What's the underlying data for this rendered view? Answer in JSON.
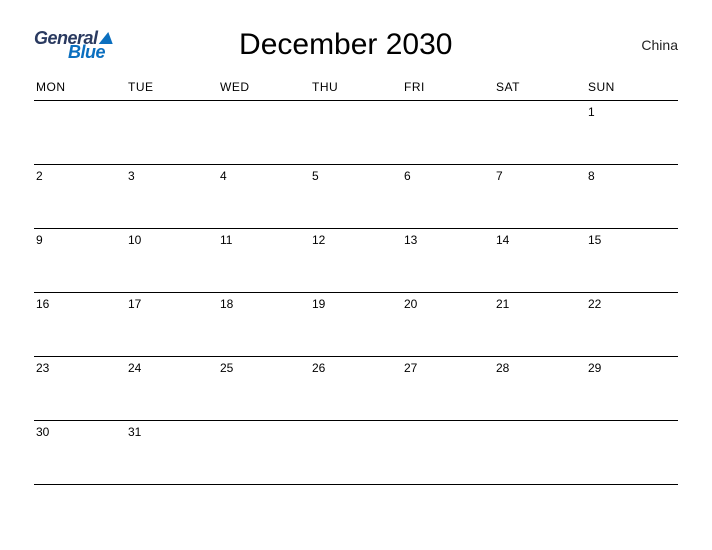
{
  "logo": {
    "word1": "General",
    "word2": "Blue"
  },
  "title": "December 2030",
  "region": "China",
  "dows": [
    "MON",
    "TUE",
    "WED",
    "THU",
    "FRI",
    "SAT",
    "SUN"
  ],
  "weeks": [
    [
      "",
      "",
      "",
      "",
      "",
      "",
      "1"
    ],
    [
      "2",
      "3",
      "4",
      "5",
      "6",
      "7",
      "8"
    ],
    [
      "9",
      "10",
      "11",
      "12",
      "13",
      "14",
      "15"
    ],
    [
      "16",
      "17",
      "18",
      "19",
      "20",
      "21",
      "22"
    ],
    [
      "23",
      "24",
      "25",
      "26",
      "27",
      "28",
      "29"
    ],
    [
      "30",
      "31",
      "",
      "",
      "",
      "",
      ""
    ]
  ]
}
